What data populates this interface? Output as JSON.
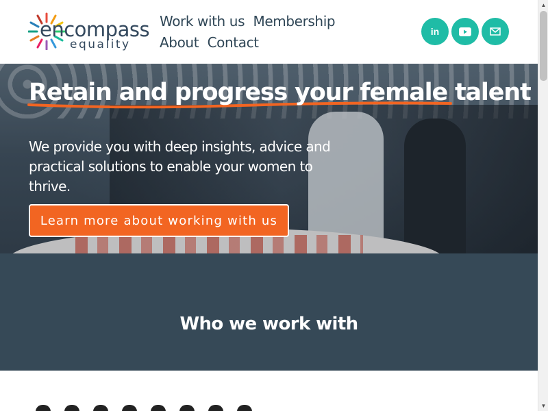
{
  "brand": {
    "name": "encompass",
    "sub": "equality"
  },
  "nav": [
    {
      "label": "Work with us"
    },
    {
      "label": "Membership"
    },
    {
      "label": "About"
    },
    {
      "label": "Contact"
    }
  ],
  "social": [
    {
      "icon": "linkedin-icon",
      "glyph": "in"
    },
    {
      "icon": "youtube-icon",
      "glyph": "▶"
    },
    {
      "icon": "email-icon",
      "glyph": "✉"
    }
  ],
  "hero": {
    "title": "Retain and progress your female talent",
    "text": "We provide you with deep insights, advice and practical solutions to enable your women to thrive.",
    "cta": "Learn more about working with us"
  },
  "section": {
    "heading": "Who we work with"
  },
  "colors": {
    "accent": "#f26522",
    "teal": "#1fbca6",
    "dark": "#364957",
    "text": "#2f4656"
  }
}
